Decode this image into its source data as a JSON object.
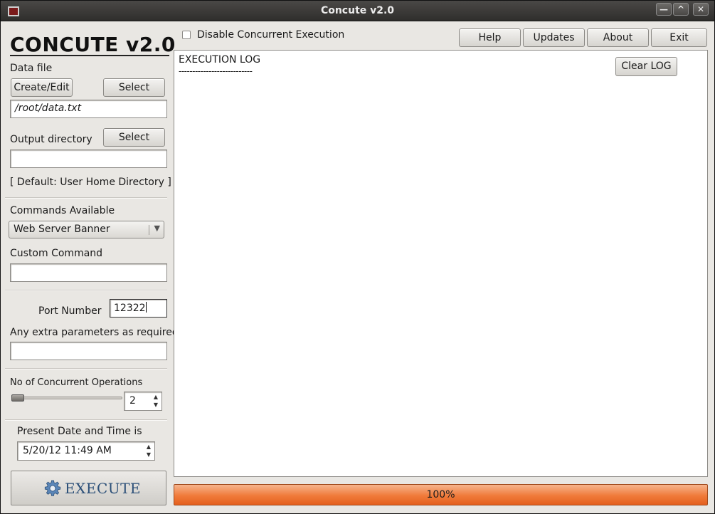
{
  "window": {
    "title": "Concute v2.0",
    "controls": {
      "minimize": "—",
      "maximize": "^",
      "close": "✕"
    }
  },
  "app_heading": "CONCUTE v2.0",
  "top": {
    "disable_concurrent_label": "Disable Concurrent Execution",
    "disable_concurrent_checked": false,
    "buttons": {
      "help": "Help",
      "updates": "Updates",
      "about": "About",
      "exit": "Exit"
    }
  },
  "sidebar": {
    "data_file_label": "Data file",
    "create_edit": "Create/Edit",
    "select_data": "Select",
    "data_file_value": "/root/data.txt",
    "output_dir_label": "Output directory",
    "select_output": "Select",
    "output_dir_value": "",
    "default_note": "[ Default: User Home Directory ]",
    "commands_label": "Commands Available",
    "commands_selected": "Web Server Banner",
    "custom_command_label": "Custom Command",
    "custom_command_value": "",
    "port_label": "Port Number",
    "port_value": "12322",
    "extra_params_label": "Any extra parameters as required",
    "extra_params_value": "",
    "concurrent_label": "No of Concurrent Operations",
    "concurrent_value": "2",
    "date_label": "Present Date and Time is",
    "date_value": "5/20/12 11:49 AM",
    "execute": "EXECUTE"
  },
  "log": {
    "title": "EXECUTION LOG",
    "separator": "---------------------------",
    "clear_button": "Clear LOG"
  },
  "progress": {
    "value": 1.0,
    "label": "100%"
  },
  "colors": {
    "progress": "#f07a3a",
    "execute_text": "#2b4f78",
    "window_bg": "#e9e7e3"
  }
}
